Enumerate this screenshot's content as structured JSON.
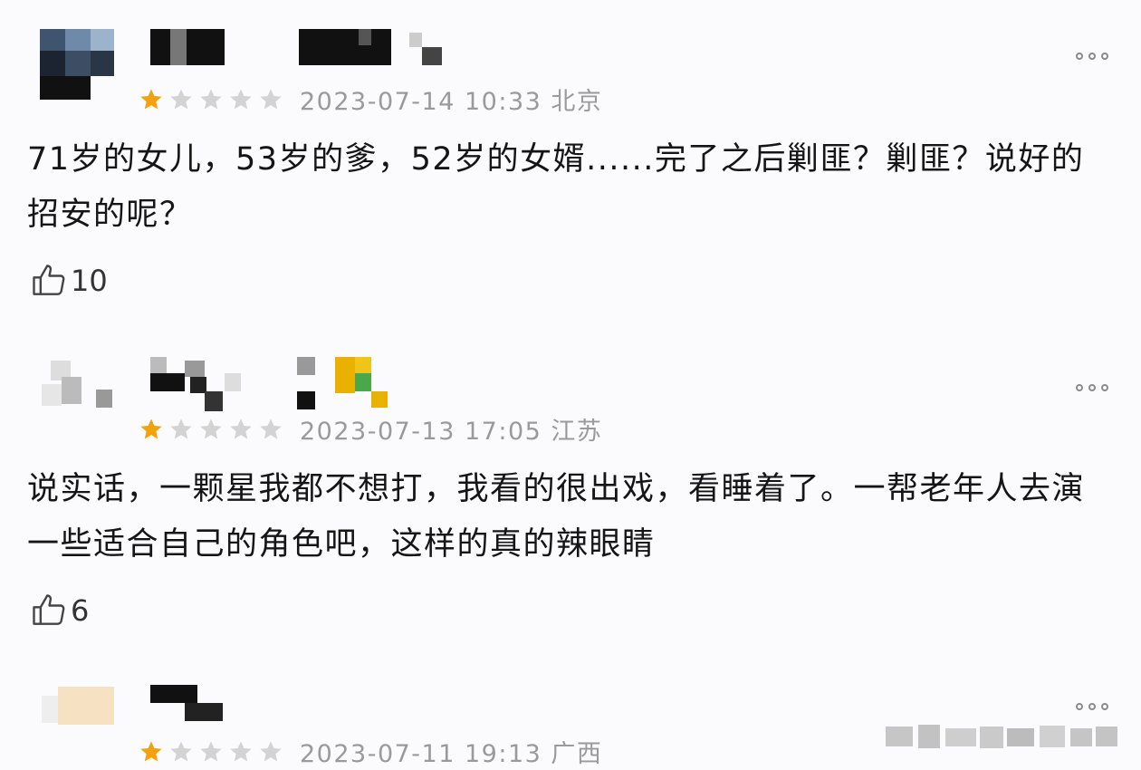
{
  "comments": [
    {
      "date": "2023-07-14 10:33 北京",
      "rating": 1,
      "text": "71岁的女儿，53岁的爹，52岁的女婿......完了之后剿匪？剿匪？说好的招安的呢？",
      "likes": "10"
    },
    {
      "date": "2023-07-13 17:05 江苏",
      "rating": 1,
      "text": "说实话，一颗星我都不想打，我看的很出戏，看睡着了。一帮老年人去演一些适合自己的角色吧，这样的真的辣眼睛",
      "likes": "6"
    },
    {
      "date": "2023-07-11 19:13 广西",
      "rating": 1
    }
  ],
  "icons": {
    "more": "more-dots-icon",
    "like": "thumbs-up-icon",
    "star_filled": "star-filled-icon",
    "star_empty": "star-empty-icon"
  },
  "colors": {
    "star_filled": "#f2a20f",
    "star_empty": "#d3d3d3",
    "meta_text": "#9a9a9a",
    "body_text": "#151515",
    "background": "#fbfafc"
  }
}
